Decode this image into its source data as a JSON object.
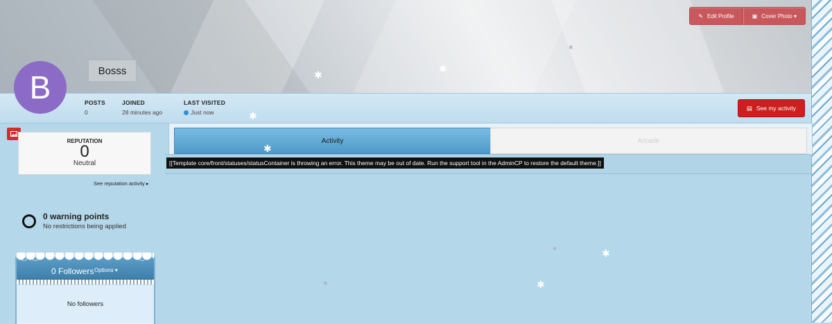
{
  "cover": {
    "edit_profile_label": "Edit Profile",
    "cover_photo_label": "Cover Photo ▾"
  },
  "profile": {
    "avatar_letter": "B",
    "username": "Bosss"
  },
  "stats": {
    "posts_label": "POSTS",
    "posts_value": "0",
    "joined_label": "JOINED",
    "joined_value": "28 minutes ago",
    "last_visited_label": "LAST VISITED",
    "last_visited_value": "Just now"
  },
  "actions": {
    "see_activity_label": "See my activity"
  },
  "reputation": {
    "title": "REPUTATION",
    "value": "0",
    "status": "Neutral",
    "link": "See reputation activity ▸"
  },
  "warnings": {
    "title": "0 warning points",
    "subtitle": "No restrictions being applied"
  },
  "followers": {
    "title": "0 Followers",
    "options_label": "Options ▾",
    "empty_text": "No followers"
  },
  "tabs": [
    {
      "label": "Activity",
      "active": true
    },
    {
      "label": "Arcade",
      "active": false
    }
  ],
  "error_message": "[[Template core/front/statuses/statusContainer is throwing an error. This theme may be out of date. Run the support tool in the AdminCP to restore the default theme.]]",
  "colors": {
    "accent_red": "#cc1f1f",
    "avatar_purple": "#8c6bc7",
    "tab_active_blue": "#4f99c8"
  }
}
